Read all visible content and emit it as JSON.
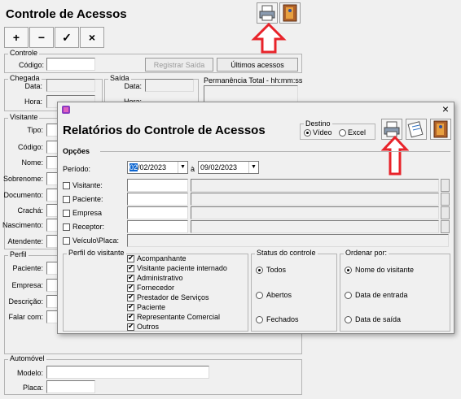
{
  "main": {
    "title": "Controle de Acessos",
    "toolbar": [
      "+",
      "−",
      "✓",
      "×"
    ],
    "controle": {
      "group": "Controle",
      "codigo_label": "Código:",
      "registrar_label": "Registrar Saída",
      "ultimos_label": "Últimos acessos"
    },
    "chegada": {
      "group": "Chegada",
      "data": "Data:",
      "hora": "Hora:"
    },
    "saida": {
      "group": "Saída",
      "data": "Data:",
      "hora": "Hora:"
    },
    "permanencia": "Permanência Total - hh:mm:ss",
    "visitante": {
      "group": "Visitante",
      "labels": [
        "Tipo:",
        "Código:",
        "Nome:",
        "Sobrenome:",
        "Documento:",
        "Crachá:",
        "Nascimento:",
        "Atendente:"
      ]
    },
    "perfil": {
      "group": "Perfil",
      "labels": [
        "Paciente:",
        "Empresa:",
        "Descrição:",
        "Falar com:"
      ]
    },
    "automovel": {
      "group": "Automóvel",
      "modelo": "Modelo:",
      "placa": "Placa:"
    }
  },
  "dialog": {
    "close": "×",
    "title": "Relatórios do Controle de Acessos",
    "destino": {
      "label": "Destino",
      "video": "Vídeo",
      "excel": "Excel",
      "selected": "video"
    },
    "opcoes": "Opções",
    "periodo": {
      "label": "Período:",
      "from_day": "02",
      "from_rest": "/02/2023",
      "separator": "à",
      "to": "09/02/2023"
    },
    "filters": [
      "Visitante:",
      "Paciente:",
      "Empresa",
      "Receptor:",
      "Veículo\\Placa:"
    ],
    "perfil_visitante": {
      "label": "Perfil do visitante",
      "items": [
        "Acompanhante",
        "Visitante paciente internado",
        "Administrativo",
        "Fornecedor",
        "Prestador de Serviços",
        "Paciente",
        "Representante Comercial",
        "Outros"
      ]
    },
    "status": {
      "label": "Status do controle",
      "options": [
        "Todos",
        "Abertos",
        "Fechados"
      ],
      "selected": "Todos"
    },
    "ordenar": {
      "label": "Ordenar por:",
      "options": [
        "Nome do visitante",
        "Data de entrada",
        "Data de saída"
      ],
      "selected": "Nome do visitante"
    }
  },
  "colors": {
    "arrow": "#e8232a",
    "selection": "#0a64d0"
  },
  "icons": [
    "printer-icon",
    "exit-door-icon",
    "report-icon"
  ]
}
